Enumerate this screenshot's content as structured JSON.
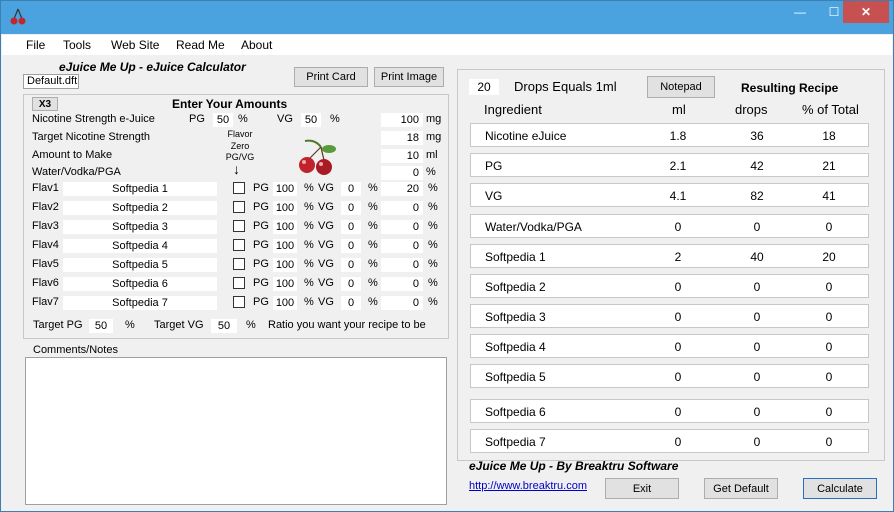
{
  "window": {
    "minimize": "—",
    "maximize": "☐",
    "close": "✕"
  },
  "menu": [
    "File",
    "Tools",
    "Web Site",
    "Read Me",
    "About"
  ],
  "app_title": "eJuice Me Up - eJuice Calculator",
  "file_name": "Default.dft",
  "print_card": "Print Card",
  "print_image": "Print Image",
  "x3": "X3",
  "enter_amounts": "Enter Your Amounts",
  "nicotine": {
    "label": "Nicotine Strength e-Juice",
    "pg_label": "PG",
    "pg": "50",
    "vg_label": "VG",
    "vg": "50",
    "pct": "%",
    "value": "100",
    "unit": "mg"
  },
  "target_nicotine": {
    "label": "Target Nicotine Strength",
    "value": "18",
    "unit": "mg"
  },
  "amount": {
    "label": "Amount to Make",
    "value": "10",
    "unit": "ml"
  },
  "water": {
    "label": "Water/Vodka/PGA",
    "value": "0",
    "unit": "%"
  },
  "flavor_zero": [
    "Flavor",
    "Zero",
    "PG/VG"
  ],
  "arrow": "↓",
  "flavors": [
    {
      "label": "Flav1",
      "name": "Softpedia 1",
      "pg": "100",
      "vg": "0",
      "value": "20"
    },
    {
      "label": "Flav2",
      "name": "Softpedia 2",
      "pg": "100",
      "vg": "0",
      "value": "0"
    },
    {
      "label": "Flav3",
      "name": "Softpedia 3",
      "pg": "100",
      "vg": "0",
      "value": "0"
    },
    {
      "label": "Flav4",
      "name": "Softpedia 4",
      "pg": "100",
      "vg": "0",
      "value": "0"
    },
    {
      "label": "Flav5",
      "name": "Softpedia  5",
      "pg": "100",
      "vg": "0",
      "value": "0"
    },
    {
      "label": "Flav6",
      "name": "Softpedia  6",
      "pg": "100",
      "vg": "0",
      "value": "0"
    },
    {
      "label": "Flav7",
      "name": "Softpedia  7",
      "pg": "100",
      "vg": "0",
      "value": "0"
    }
  ],
  "pg_short": "PG",
  "vg_short": "VG",
  "pct": "%",
  "target": {
    "pg_label": "Target PG",
    "pg": "50",
    "vg_label": "Target VG",
    "vg": "50",
    "pct": "%",
    "ratio_text": "Ratio you want your recipe to be"
  },
  "comments_label": "Comments/Notes",
  "drops": {
    "value": "20",
    "label": "Drops Equals 1ml"
  },
  "notepad": "Notepad",
  "resulting_recipe": "Resulting Recipe",
  "headers": {
    "ingredient": "Ingredient",
    "ml": "ml",
    "drops": "drops",
    "pct_total": "% of Total"
  },
  "recipe": [
    {
      "name": "Nicotine eJuice",
      "ml": "1.8",
      "drops": "36",
      "pct": "18"
    },
    {
      "name": "PG",
      "ml": "2.1",
      "drops": "42",
      "pct": "21"
    },
    {
      "name": "VG",
      "ml": "4.1",
      "drops": "82",
      "pct": "41"
    },
    {
      "name": "Water/Vodka/PGA",
      "ml": "0",
      "drops": "0",
      "pct": "0"
    },
    {
      "name": "Softpedia 1",
      "ml": "2",
      "drops": "40",
      "pct": "20"
    },
    {
      "name": "Softpedia 2",
      "ml": "0",
      "drops": "0",
      "pct": "0"
    },
    {
      "name": "Softpedia 3",
      "ml": "0",
      "drops": "0",
      "pct": "0"
    },
    {
      "name": "Softpedia 4",
      "ml": "0",
      "drops": "0",
      "pct": "0"
    },
    {
      "name": "Softpedia  5",
      "ml": "0",
      "drops": "0",
      "pct": "0"
    },
    {
      "name": "Softpedia  6",
      "ml": "0",
      "drops": "0",
      "pct": "0"
    },
    {
      "name": "Softpedia  7",
      "ml": "0",
      "drops": "0",
      "pct": "0"
    }
  ],
  "footer_title": "eJuice Me Up -  By Breaktru Software",
  "link": "http://www.breaktru.com",
  "exit": "Exit",
  "get_default": "Get Default",
  "calculate": "Calculate",
  "colors": {
    "titlebar": "#4aa3df",
    "close": "#c75050",
    "link": "#0000cc"
  }
}
